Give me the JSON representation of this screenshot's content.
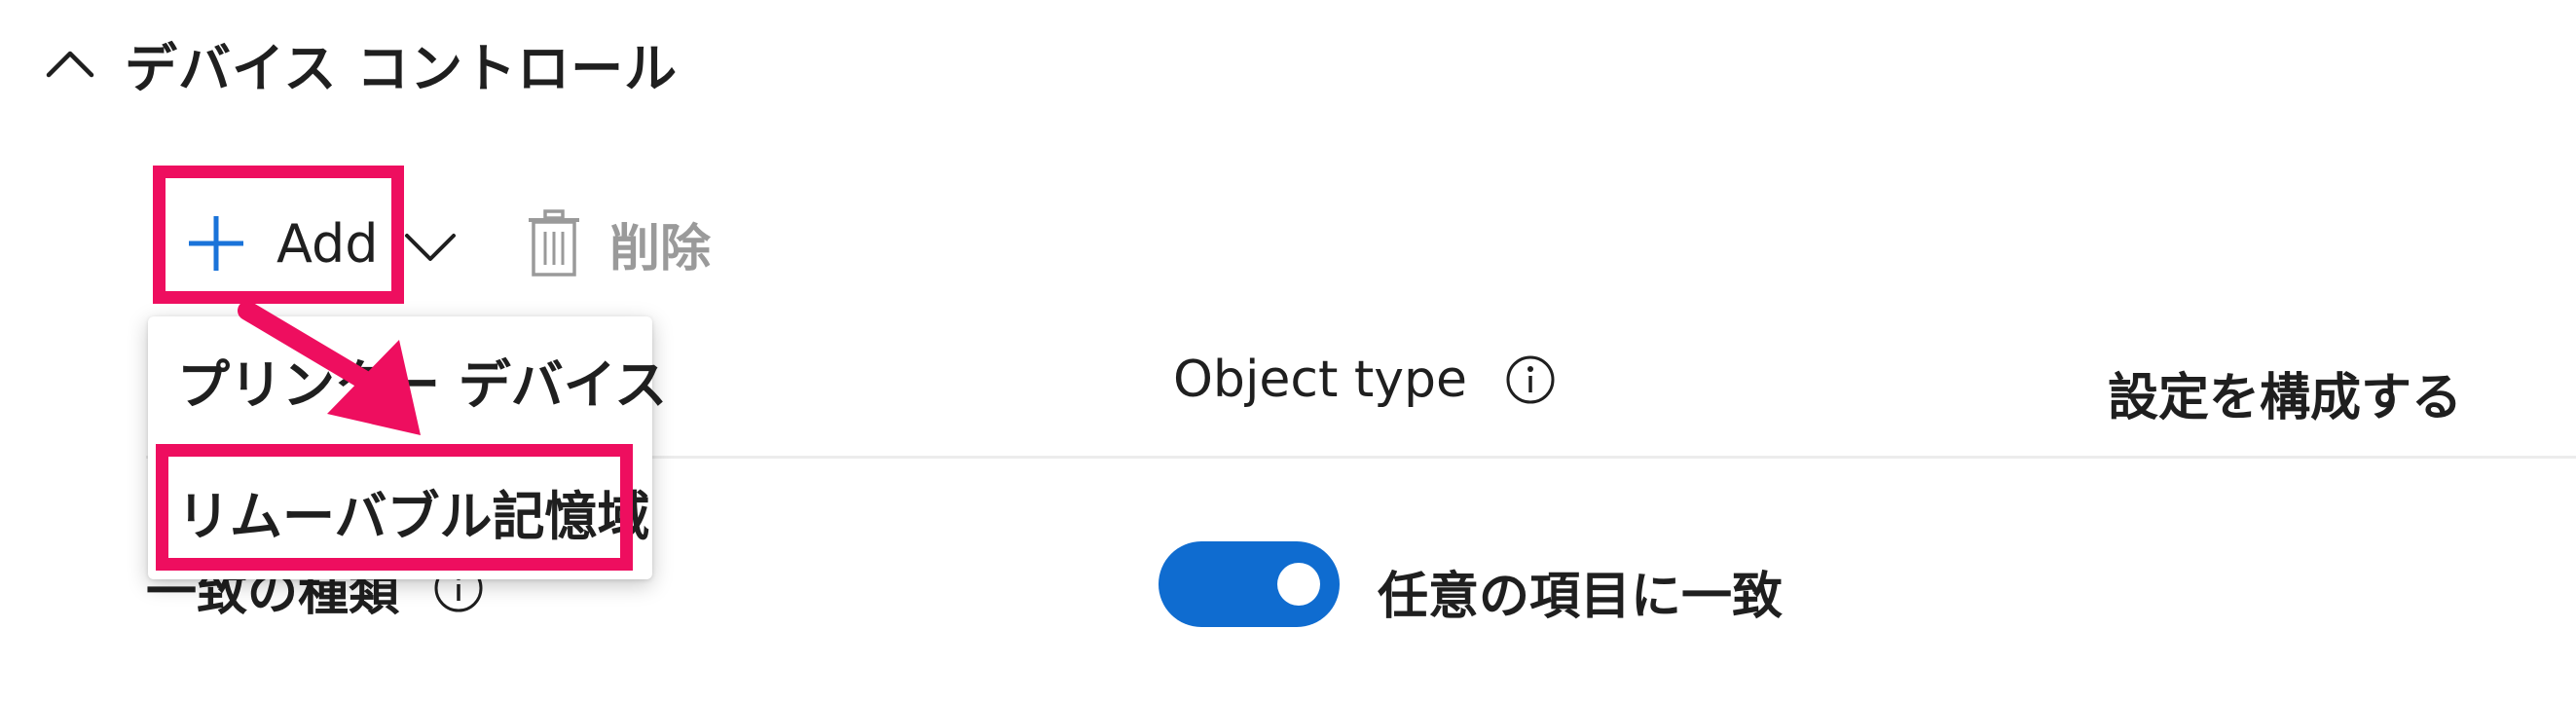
{
  "section": {
    "title": "デバイス コントロール",
    "toggle_icon": "chevron-up-icon"
  },
  "toolbar": {
    "add_label": "Add",
    "add_icon": "plus-icon",
    "add_dropdown_icon": "chevron-down-icon",
    "delete_label": "削除",
    "delete_icon": "trash-icon"
  },
  "table": {
    "columns": [
      {
        "label": "Object type",
        "info_icon": "info-icon"
      },
      {
        "label": "設定を構成する"
      }
    ],
    "match_type_label": "一致の種類",
    "match_toggle_on": true,
    "match_toggle_label": "任意の項目に一致"
  },
  "add_menu": {
    "items": [
      {
        "label": "プリンター デバイス"
      },
      {
        "label": "リムーバブル記憶域"
      }
    ]
  },
  "annotation": {
    "highlight_color": "#ee0e5f",
    "arrow": "arrow-icon"
  },
  "colors": {
    "accent": "#0f6cd0",
    "highlight": "#ee0e5f",
    "disabled_text": "#9a9a9a"
  }
}
